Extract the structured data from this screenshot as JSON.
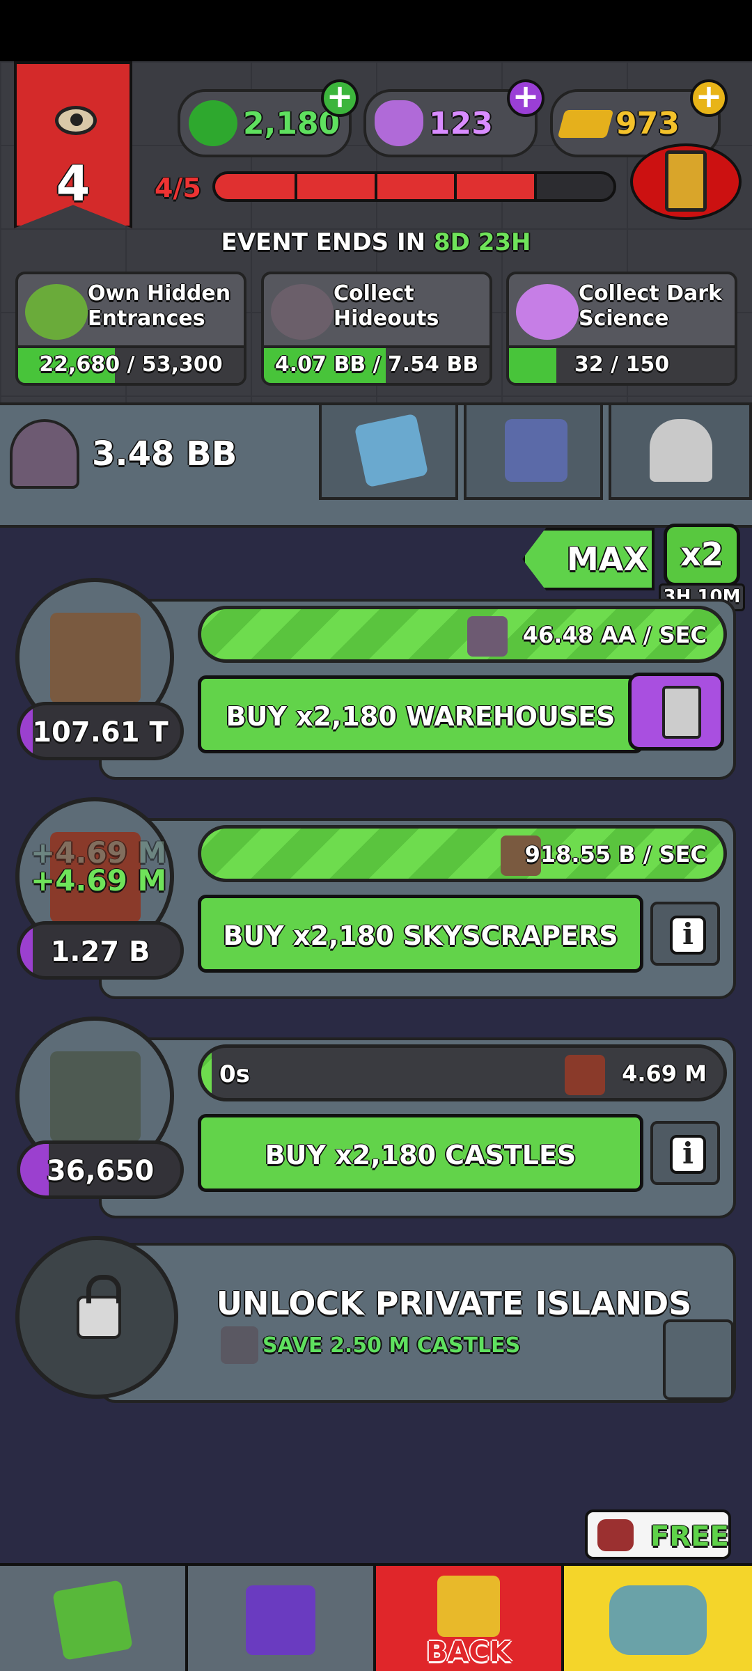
{
  "header": {
    "level": "4",
    "currencies": {
      "dark_matter": "2,180",
      "dark_science": "123",
      "gold": "973"
    },
    "xp": {
      "label": "4/5",
      "progress": 0.8
    },
    "event": {
      "prefix": "EVENT ENDS IN",
      "days": "8D",
      "hours": "23H"
    }
  },
  "quests": [
    {
      "title": "Own Hidden Entrances",
      "progress_text": "22,680 / 53,300",
      "progress": 0.43
    },
    {
      "title": "Collect Hideouts",
      "progress_text": "4.07 BB / 7.54 BB",
      "progress": 0.54
    },
    {
      "title": "Collect Dark Science",
      "progress_text": "32 / 150",
      "progress": 0.21
    }
  ],
  "resource_bar": {
    "total": "3.48 BB"
  },
  "multiplier": {
    "max_label": "MAX",
    "boost_label": "x2",
    "boost_timer": "3H 10M"
  },
  "buildings": [
    {
      "name": "warehouses",
      "count": "107.61 T",
      "count_fill": 0.08,
      "rate": "46.48 AA / SEC",
      "progress": 1.0,
      "buy_label": "BUY x2,180 WAREHOUSES"
    },
    {
      "name": "skyscrapers",
      "count": "1.27 B",
      "count_fill": 0.08,
      "rate": "918.55 B / SEC",
      "progress": 1.0,
      "floater": "+4.69 M",
      "buy_label": "BUY x2,180 SKYSCRAPERS",
      "info_label": "i"
    },
    {
      "name": "castles",
      "count": "36,650",
      "count_fill": 0.18,
      "timer": "0s",
      "rate": "4.69 M",
      "progress": 0.02,
      "buy_label": "BUY x2,180 CASTLES",
      "info_label": "i"
    }
  ],
  "locked": {
    "title": "UNLOCK PRIVATE ISLANDS",
    "requirement": "SAVE 2.50 M CASTLES"
  },
  "bottom_nav": {
    "free_label": "FREE",
    "back_label": "BACK"
  }
}
